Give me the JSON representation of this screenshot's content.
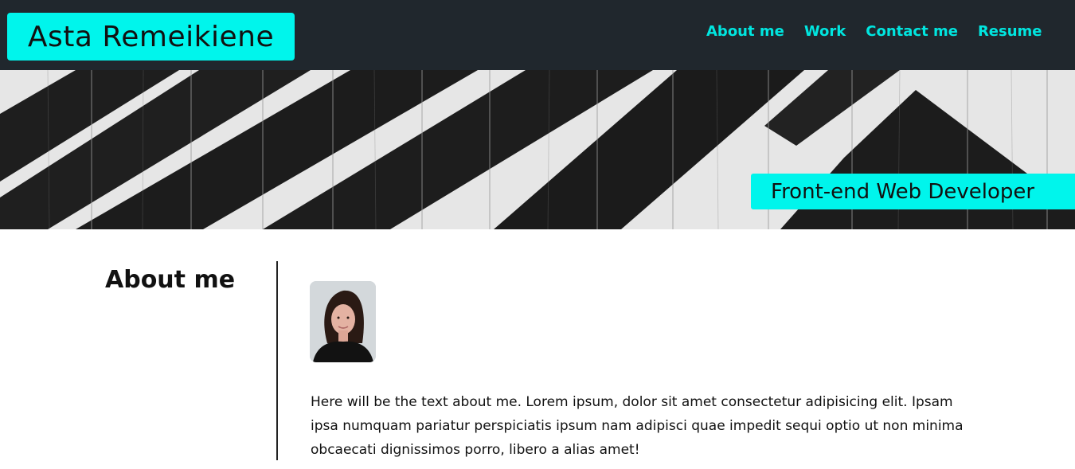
{
  "header": {
    "logo_text": "Asta Remeikiene",
    "nav": [
      {
        "label": "About me"
      },
      {
        "label": "Work"
      },
      {
        "label": "Contact me"
      },
      {
        "label": "Resume"
      }
    ]
  },
  "hero": {
    "tagline": "Front-end Web Developer"
  },
  "about": {
    "title": "About me",
    "text": "Here will be the text about me. Lorem ipsum, dolor sit amet consectetur adipisicing elit. Ipsam ipsa numquam pariatur perspiciatis ipsum nam adipisci quae impedit sequi optio ut non minima obcaecati dignissimos porro, libero a alias amet!"
  },
  "colors": {
    "header_bg": "#20272d",
    "accent": "#00f5ec",
    "nav_link": "#00e6e0"
  }
}
